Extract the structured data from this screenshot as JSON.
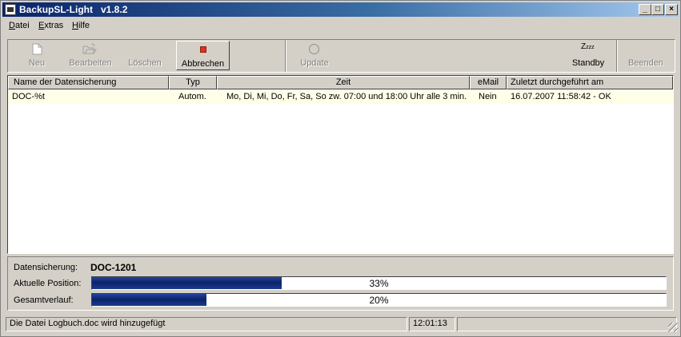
{
  "window": {
    "title": "BackupSL-Light   v1.8.2"
  },
  "caption_buttons": {
    "minimize": "_",
    "maximize": "□",
    "close": "×"
  },
  "menu": [
    {
      "underline": "D",
      "rest": "atei"
    },
    {
      "underline": "E",
      "rest": "xtras"
    },
    {
      "underline": "H",
      "rest": "ilfe"
    }
  ],
  "toolbar": {
    "neu": "Neu",
    "bearbeiten": "Bearbeiten",
    "loeschen": "Löschen",
    "abbrechen": "Abbrechen",
    "update": "Update",
    "standby": "Standby",
    "standby_glyph": "Z",
    "standby_glyph_small": "zzz",
    "beenden": "Beenden"
  },
  "table": {
    "headers": [
      "Name der Datensicherung",
      "Typ",
      "Zeit",
      "eMail",
      "Zuletzt durchgeführt am"
    ],
    "rows": [
      {
        "name": "DOC-%t",
        "typ": "Autom.",
        "zeit": "Mo, Di, Mi, Do, Fr, Sa, So zw. 07:00 und 18:00 Uhr alle 3 min.",
        "email": "Nein",
        "zuletzt": "16.07.2007 11:58:42 - OK"
      }
    ]
  },
  "progress": {
    "datensicherung_label": "Datensicherung:",
    "datensicherung_value": "DOC-1201",
    "aktuelle_label": "Aktuelle  Position:",
    "aktuelle_percent": 33,
    "aktuelle_text": "33%",
    "gesamt_label": "Gesamtverlauf:",
    "gesamt_percent": 20,
    "gesamt_text": "20%"
  },
  "statusbar": {
    "message": "Die Datei Logbuch.doc wird hinzugefügt",
    "time": "12:01:13"
  },
  "colors": {
    "title_gradient_start": "#0a246a",
    "progress_fill": "#0a246a",
    "abbrechen_icon": "#e03020"
  }
}
